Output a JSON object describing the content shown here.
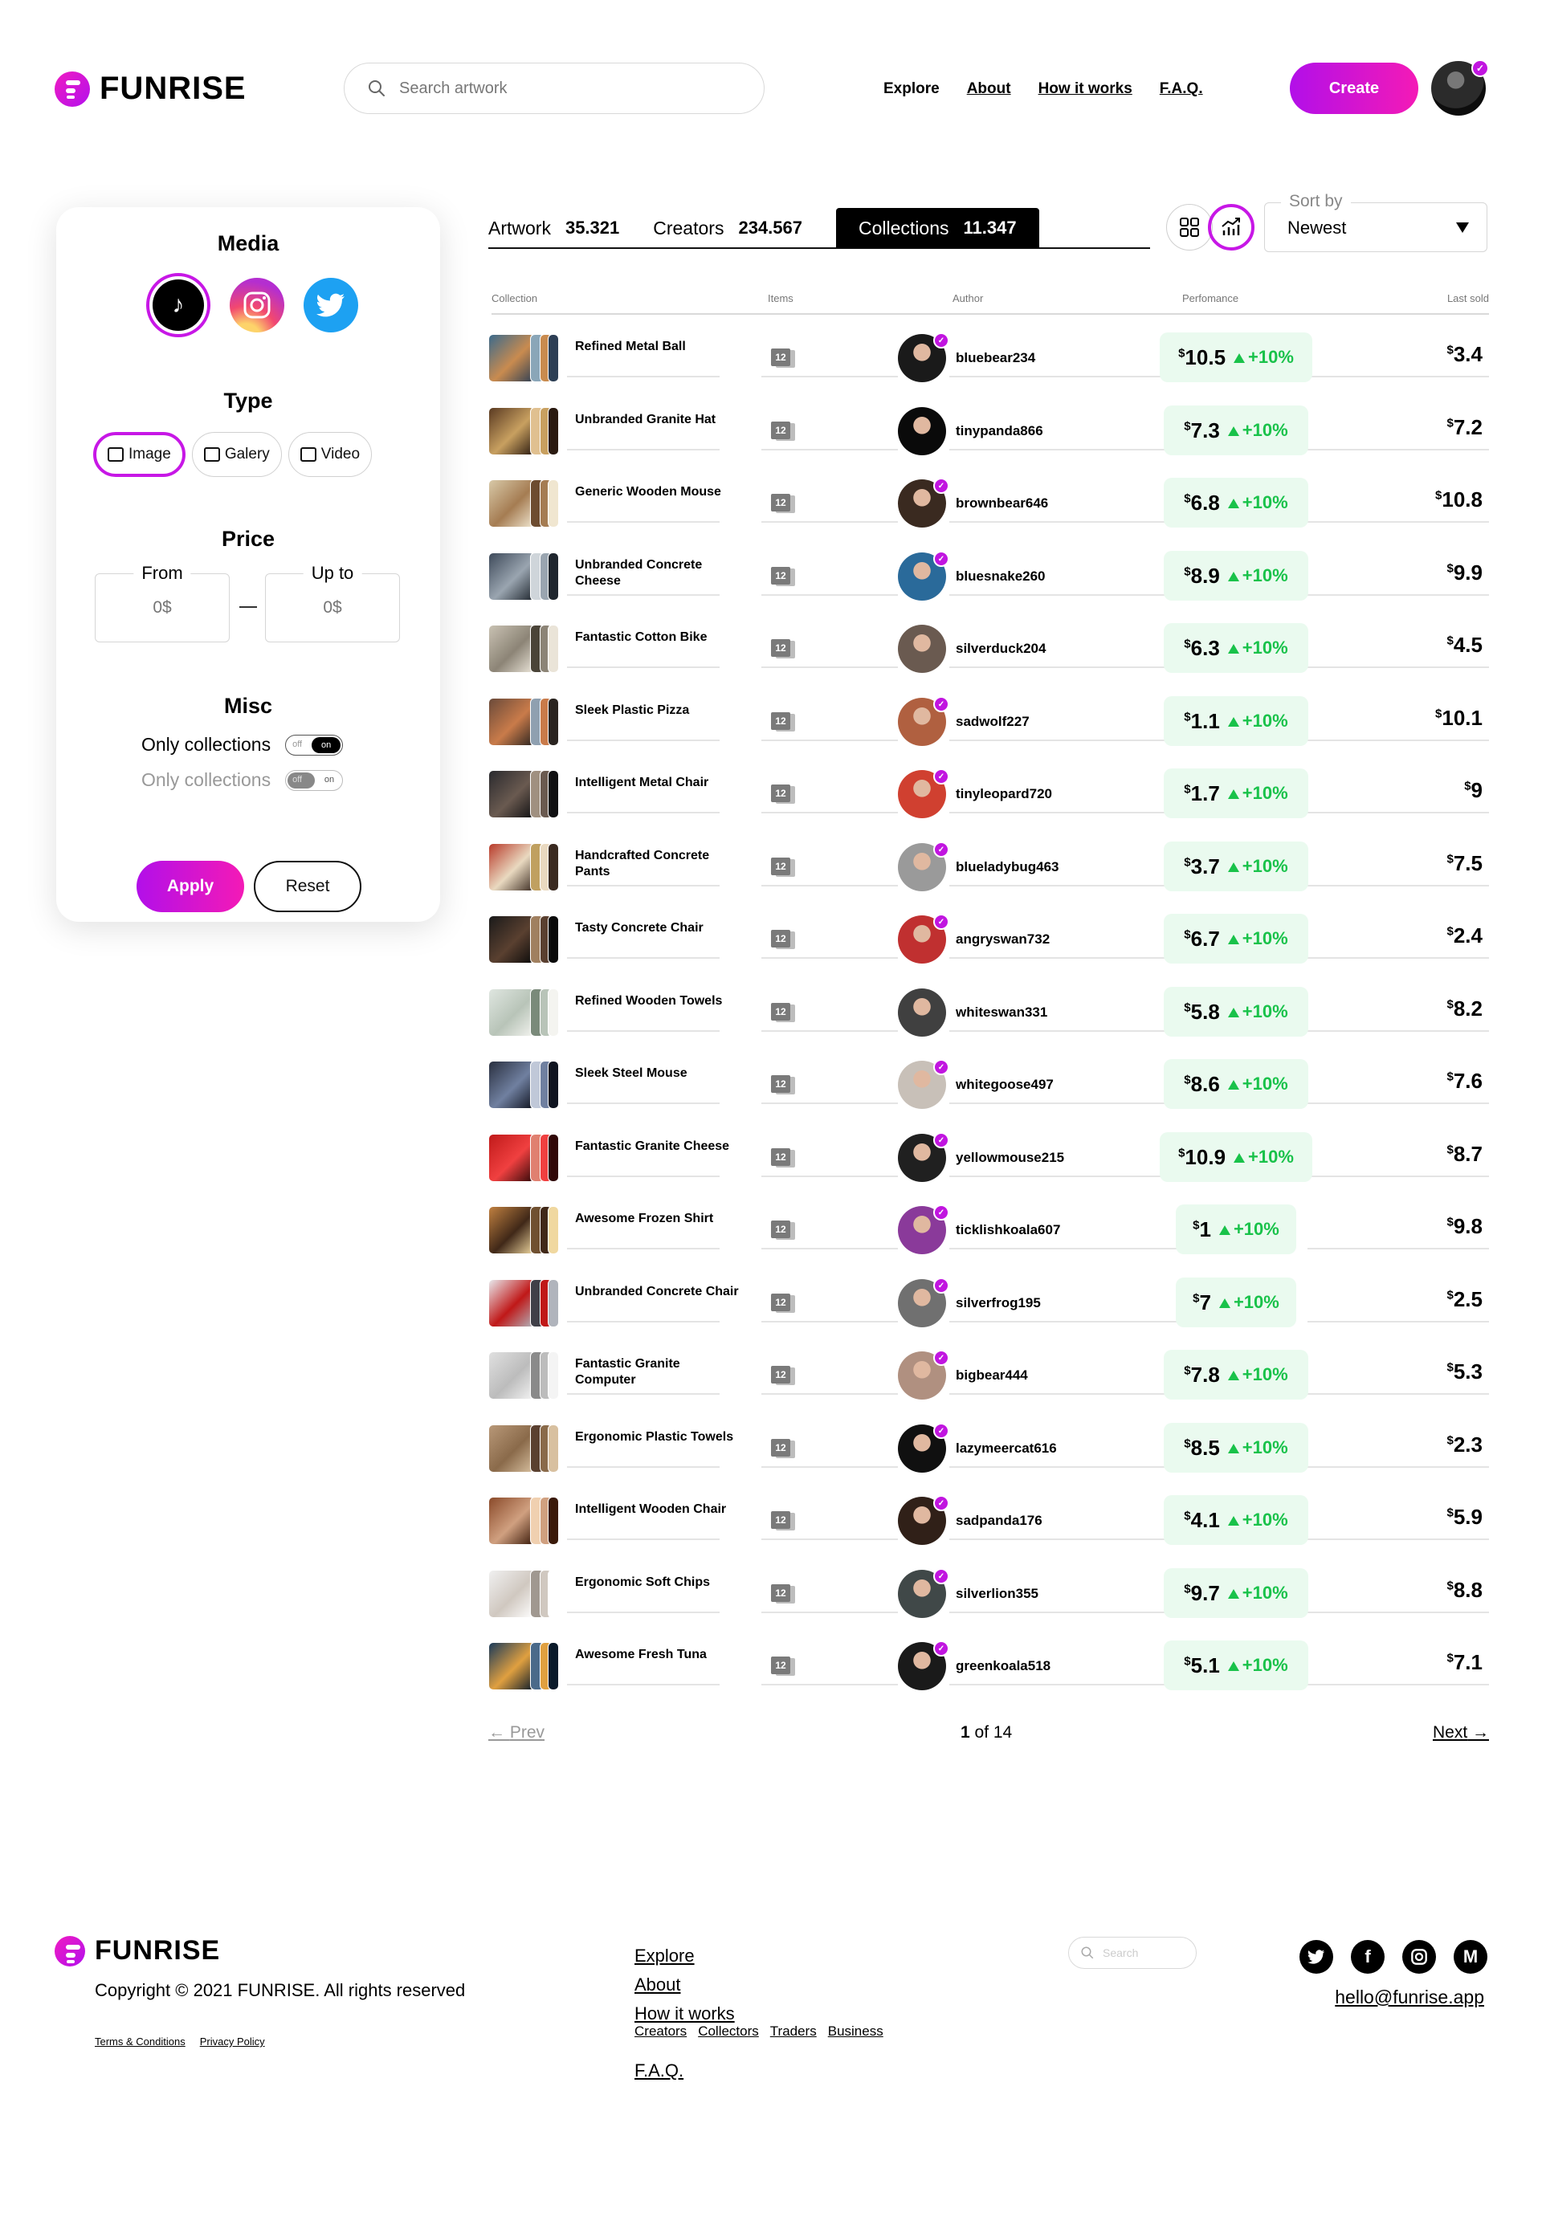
{
  "header": {
    "brand": "FUNRISE",
    "search_placeholder": "Search artwork",
    "nav": [
      {
        "label": "Explore"
      },
      {
        "label": "About"
      },
      {
        "label": "How it works"
      },
      {
        "label": "F.A.Q."
      }
    ],
    "create_label": "Create"
  },
  "filters": {
    "media_title": "Media",
    "media_icons": [
      "tiktok-icon",
      "instagram-icon",
      "twitter-icon"
    ],
    "type_title": "Type",
    "type_options": [
      {
        "label": "Image",
        "active": true
      },
      {
        "label": "Galery",
        "active": false
      },
      {
        "label": "Video",
        "active": false
      }
    ],
    "price_title": "Price",
    "price_from_label": "From",
    "price_from_placeholder": "0$",
    "price_to_label": "Up to",
    "price_to_placeholder": "0$",
    "misc_title": "Misc",
    "misc_rows": [
      {
        "label": "Only collections",
        "off": "off",
        "on": "on",
        "enabled": true
      },
      {
        "label": "Only collections",
        "off": "off",
        "on": "on",
        "enabled": false
      }
    ],
    "apply_label": "Apply",
    "reset_label": "Reset"
  },
  "tabs": [
    {
      "label": "Artwork",
      "count": "35.321",
      "active": false
    },
    {
      "label": "Creators",
      "count": "234.567",
      "active": false
    },
    {
      "label": "Collections",
      "count": "11.347",
      "active": true
    }
  ],
  "sort": {
    "label": "Sort by",
    "value": "Newest"
  },
  "table": {
    "headers": {
      "collection": "Collection",
      "items": "Items",
      "author": "Author",
      "performance": "Perfomance",
      "last_sold": "Last sold"
    },
    "rows": [
      {
        "name": "Refined Metal Ball",
        "items": "12",
        "author": "bluebear234",
        "perf": "10.5",
        "pct": "+10%",
        "last": "3.4",
        "verified": true
      },
      {
        "name": "Unbranded Granite Hat",
        "items": "12",
        "author": "tinypanda866",
        "perf": "7.3",
        "pct": "+10%",
        "last": "7.2",
        "verified": false
      },
      {
        "name": "Generic Wooden Mouse",
        "items": "12",
        "author": "brownbear646",
        "perf": "6.8",
        "pct": "+10%",
        "last": "10.8",
        "verified": true
      },
      {
        "name": "Unbranded Concrete Cheese",
        "items": "12",
        "author": "bluesnake260",
        "perf": "8.9",
        "pct": "+10%",
        "last": "9.9",
        "verified": true
      },
      {
        "name": "Fantastic Cotton Bike",
        "items": "12",
        "author": "silverduck204",
        "perf": "6.3",
        "pct": "+10%",
        "last": "4.5",
        "verified": false
      },
      {
        "name": "Sleek Plastic Pizza",
        "items": "12",
        "author": "sadwolf227",
        "perf": "1.1",
        "pct": "+10%",
        "last": "10.1",
        "verified": true
      },
      {
        "name": "Intelligent Metal Chair",
        "items": "12",
        "author": "tinyleopard720",
        "perf": "1.7",
        "pct": "+10%",
        "last": "9",
        "verified": true
      },
      {
        "name": "Handcrafted Concrete Pants",
        "items": "12",
        "author": "blueladybug463",
        "perf": "3.7",
        "pct": "+10%",
        "last": "7.5",
        "verified": true
      },
      {
        "name": "Tasty Concrete Chair",
        "items": "12",
        "author": "angryswan732",
        "perf": "6.7",
        "pct": "+10%",
        "last": "2.4",
        "verified": true
      },
      {
        "name": "Refined Wooden Towels",
        "items": "12",
        "author": "whiteswan331",
        "perf": "5.8",
        "pct": "+10%",
        "last": "8.2",
        "verified": false
      },
      {
        "name": "Sleek Steel Mouse",
        "items": "12",
        "author": "whitegoose497",
        "perf": "8.6",
        "pct": "+10%",
        "last": "7.6",
        "verified": true
      },
      {
        "name": "Fantastic Granite Cheese",
        "items": "12",
        "author": "yellowmouse215",
        "perf": "10.9",
        "pct": "+10%",
        "last": "8.7",
        "verified": true
      },
      {
        "name": "Awesome Frozen Shirt",
        "items": "12",
        "author": "ticklishkoala607",
        "perf": "1",
        "pct": "+10%",
        "last": "9.8",
        "verified": true
      },
      {
        "name": "Unbranded Concrete Chair",
        "items": "12",
        "author": "silverfrog195",
        "perf": "7",
        "pct": "+10%",
        "last": "2.5",
        "verified": true
      },
      {
        "name": "Fantastic Granite Computer",
        "items": "12",
        "author": "bigbear444",
        "perf": "7.8",
        "pct": "+10%",
        "last": "5.3",
        "verified": true
      },
      {
        "name": "Ergonomic Plastic Towels",
        "items": "12",
        "author": "lazymeercat616",
        "perf": "8.5",
        "pct": "+10%",
        "last": "2.3",
        "verified": true
      },
      {
        "name": "Intelligent Wooden Chair",
        "items": "12",
        "author": "sadpanda176",
        "perf": "4.1",
        "pct": "+10%",
        "last": "5.9",
        "verified": true
      },
      {
        "name": "Ergonomic Soft Chips",
        "items": "12",
        "author": "silverlion355",
        "perf": "9.7",
        "pct": "+10%",
        "last": "8.8",
        "verified": true
      },
      {
        "name": "Awesome Fresh Tuna",
        "items": "12",
        "author": "greenkoala518",
        "perf": "5.1",
        "pct": "+10%",
        "last": "7.1",
        "verified": true
      }
    ]
  },
  "pagination": {
    "prev": "Prev",
    "current": "1",
    "of": "of 14",
    "next": "Next"
  },
  "footer": {
    "brand": "FUNRISE",
    "copyright": "Copyright © 2021 FUNRISE. All rights reserved",
    "terms": "Terms & Conditions",
    "privacy": "Privacy Policy",
    "nav": [
      "Explore",
      "About",
      "How it works"
    ],
    "sub_nav": [
      "Creators",
      "Collectors",
      "Traders",
      "Business"
    ],
    "faq": "F.A.Q.",
    "search_placeholder": "Search",
    "socials": [
      "twitter-icon",
      "facebook-icon",
      "instagram-icon",
      "medium-icon"
    ],
    "email": "hello@funrise.app"
  },
  "colors": {
    "accent": "#c717e6",
    "positive": "#19c24a",
    "positive_bg": "#eafaef"
  }
}
